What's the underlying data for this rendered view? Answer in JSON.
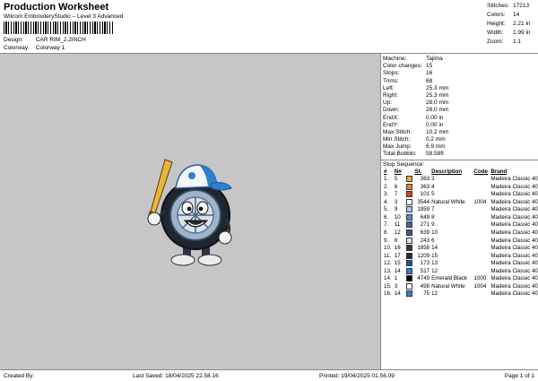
{
  "header": {
    "title": "Production Worksheet",
    "subtitle": "Wilcom EmbroideryStudio – Level 3 Advanced",
    "design_label": "Design:",
    "design_value": "CAR RIM_2,2INCH",
    "colorway_label": "Colorway:",
    "colorway_value": "Colorway 1"
  },
  "summary": [
    {
      "label": "Stitches:",
      "value": "17213"
    },
    {
      "label": "Colors:",
      "value": "14"
    },
    {
      "label": "Height:",
      "value": "2.21 in"
    },
    {
      "label": "Width:",
      "value": "1.99 in"
    },
    {
      "label": "Zoom:",
      "value": "1:1"
    }
  ],
  "machine_info": [
    {
      "label": "Machine:",
      "value": "Tajima"
    },
    {
      "label": "Color changes:",
      "value": "15"
    },
    {
      "label": "Stops:",
      "value": "16"
    },
    {
      "label": "Trims:",
      "value": "68"
    },
    {
      "label": "Left:",
      "value": "25.3 mm"
    },
    {
      "label": "Right:",
      "value": "25.3 mm"
    },
    {
      "label": "Up:",
      "value": "28.0 mm"
    },
    {
      "label": "Down:",
      "value": "28.0 mm"
    },
    {
      "label": "EndX:",
      "value": "0.00 in"
    },
    {
      "label": "EndY:",
      "value": "0.00 in"
    },
    {
      "label": "Max Stitch:",
      "value": "10.2 mm"
    },
    {
      "label": "Min Stitch:",
      "value": "0.2 mm"
    },
    {
      "label": "Max Jump:",
      "value": "6.9 mm"
    },
    {
      "label": "Total Bobbin:",
      "value": "58.58ft"
    }
  ],
  "stop_sequence": {
    "title": "Stop Sequence:",
    "headers": {
      "num": "#",
      "n": "N#",
      "st": "St.",
      "desc": "Description",
      "code": "Code",
      "brand": "Brand"
    },
    "rows": [
      {
        "num": "1.",
        "n": "5",
        "color": "#f2a93b",
        "st": "363",
        "desc": "3",
        "code": "",
        "brand": "Madeira Classic 40"
      },
      {
        "num": "2.",
        "n": "6",
        "color": "#e8862a",
        "st": "363",
        "desc": "4",
        "code": "",
        "brand": "Madeira Classic 40"
      },
      {
        "num": "3.",
        "n": "7",
        "color": "#c9471c",
        "st": "101",
        "desc": "5",
        "code": "",
        "brand": "Madeira Classic 40"
      },
      {
        "num": "4.",
        "n": "3",
        "color": "#ffffff",
        "st": "3544",
        "desc": "Natural White",
        "code": "1004",
        "brand": "Madeira Classic 40"
      },
      {
        "num": "5.",
        "n": "9",
        "color": "#a9c9e8",
        "st": "1959",
        "desc": "7",
        "code": "",
        "brand": "Madeira Classic 40"
      },
      {
        "num": "6.",
        "n": "10",
        "color": "#5e88c4",
        "st": "649",
        "desc": "8",
        "code": "",
        "brand": "Madeira Classic 40"
      },
      {
        "num": "7.",
        "n": "11",
        "color": "#3f69a8",
        "st": "271",
        "desc": "9",
        "code": "",
        "brand": "Madeira Classic 40"
      },
      {
        "num": "8.",
        "n": "12",
        "color": "#3b5b8c",
        "st": "639",
        "desc": "10",
        "code": "",
        "brand": "Madeira Classic 40"
      },
      {
        "num": "9.",
        "n": "8",
        "color": "#d4e6f5",
        "st": "243",
        "desc": "6",
        "code": "",
        "brand": "Madeira Classic 40"
      },
      {
        "num": "10.",
        "n": "16",
        "color": "#3a3a3a",
        "st": "1858",
        "desc": "14",
        "code": "",
        "brand": "Madeira Classic 40"
      },
      {
        "num": "11.",
        "n": "17",
        "color": "#1e2a3a",
        "st": "1209",
        "desc": "15",
        "code": "",
        "brand": "Madeira Classic 40"
      },
      {
        "num": "12.",
        "n": "15",
        "color": "#1f4fa8",
        "st": "173",
        "desc": "13",
        "code": "",
        "brand": "Madeira Classic 40"
      },
      {
        "num": "13.",
        "n": "14",
        "color": "#2f7fd1",
        "st": "517",
        "desc": "12",
        "code": "",
        "brand": "Madeira Classic 40"
      },
      {
        "num": "14.",
        "n": "1",
        "color": "#000000",
        "st": "4749",
        "desc": "Emerald Black",
        "code": "1000",
        "brand": "Madeira Classic 40"
      },
      {
        "num": "15.",
        "n": "3",
        "color": "#ffffff",
        "st": "498",
        "desc": "Natural White",
        "code": "1004",
        "brand": "Madeira Classic 40"
      },
      {
        "num": "16.",
        "n": "14",
        "color": "#2f7fd1",
        "st": "75",
        "desc": "12",
        "code": "",
        "brand": "Madeira Classic 40"
      }
    ]
  },
  "footer": {
    "created_by": "Created By:",
    "last_saved": "Last Saved: 18/04/2025 22.58.16",
    "printed": "Printed: 19/04/2025 01.56.09",
    "page": "Page 1 of 1"
  }
}
